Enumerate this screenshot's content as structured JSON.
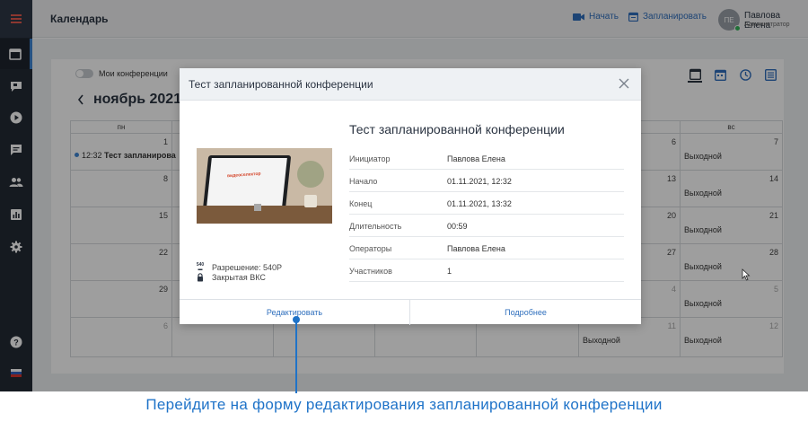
{
  "topbar": {
    "title": "Календарь",
    "start_label": "Начать",
    "schedule_label": "Запланировать",
    "user_initials": "ПЕ",
    "user_name": "Павлова Елена",
    "user_role": "Администратор"
  },
  "calendar": {
    "my_conferences_label": "Мои конференции",
    "month_title": "ноябрь 2021",
    "weekday_first": "пн",
    "weekday_last": "вс",
    "left_column_days": [
      "1",
      "8",
      "15",
      "22",
      "29",
      "6"
    ],
    "sat_column": [
      "6",
      "13",
      "20",
      "27",
      "4",
      "11"
    ],
    "sun_column": [
      "7",
      "14",
      "21",
      "28",
      "5",
      "12"
    ],
    "day_off_label": "Выходной",
    "event_time": "12:32",
    "event_title": "Тест запланирова"
  },
  "modal": {
    "header_title": "Тест запланированной конференции",
    "title": "Тест запланированной конференции",
    "rows": [
      {
        "key": "Инициатор",
        "value": "Павлова Елена"
      },
      {
        "key": "Начало",
        "value": "01.11.2021, 12:32"
      },
      {
        "key": "Конец",
        "value": "01.11.2021, 13:32"
      },
      {
        "key": "Длительность",
        "value": "00:59"
      },
      {
        "key": "Операторы",
        "value": "Павлова Елена"
      },
      {
        "key": "Участников",
        "value": "1"
      }
    ],
    "resolution_icon": "540",
    "resolution": "Разрешение: 540P",
    "closed_vks": "Закрытая ВКС",
    "edit_label": "Редактировать",
    "details_label": "Подробнее",
    "thumb_logo": "видеоселектор"
  },
  "caption": "Перейдите на форму редактирования запланированной конференции",
  "colors": {
    "accent": "#1f73c8",
    "sidebar": "#232a35",
    "link": "#2f6fbd"
  }
}
